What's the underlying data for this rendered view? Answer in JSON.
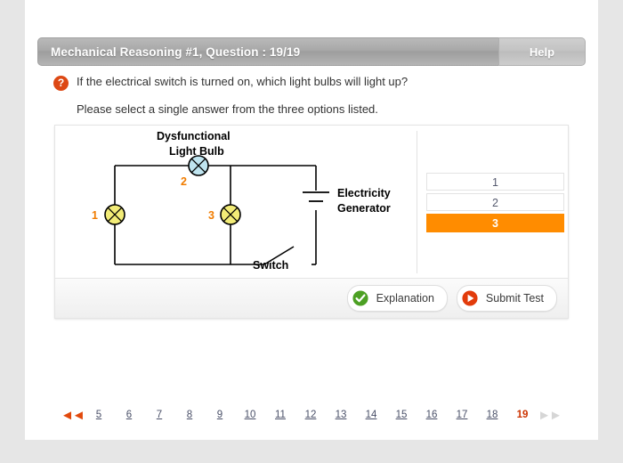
{
  "header": {
    "title": "Mechanical Reasoning #1, Question : 19/19",
    "help_label": "Help"
  },
  "question": {
    "icon": "question-mark-icon",
    "text": "If the electrical switch is turned on, which light bulbs will light up?",
    "instruction": "Please select a single answer from the three options listed."
  },
  "diagram": {
    "labels": {
      "dysfunctional_line1": "Dysfunctional",
      "dysfunctional_line2": "Light Bulb",
      "generator_line1": "Electricity",
      "generator_line2": "Generator",
      "switch": "Switch"
    },
    "bulbs": [
      {
        "number": "1",
        "state": "lit",
        "color": "#f2ec77"
      },
      {
        "number": "2",
        "state": "dysfunctional",
        "color": "#bfe4ef"
      },
      {
        "number": "3",
        "state": "lit",
        "color": "#f2ec77"
      }
    ],
    "accent_color": "#f07c00"
  },
  "options": {
    "items": [
      {
        "label": "1",
        "selected": false
      },
      {
        "label": "2",
        "selected": false
      },
      {
        "label": "3",
        "selected": true
      }
    ],
    "selected_color": "#ff8c00"
  },
  "footer": {
    "explanation_label": "Explanation",
    "explanation_icon": "check-circle-icon",
    "explanation_color": "#4ca023",
    "submit_label": "Submit Test",
    "submit_icon": "play-circle-icon",
    "submit_color": "#e23b0b"
  },
  "pagination": {
    "prev_icon": "double-left-arrow-icon",
    "next_icon": "double-right-arrow-icon",
    "pages": [
      "5",
      "6",
      "7",
      "8",
      "9",
      "10",
      "11",
      "12",
      "13",
      "14",
      "15",
      "16",
      "17",
      "18",
      "19"
    ],
    "current": "19",
    "prev_color": "#e2490c",
    "next_color": "#d6d6d6",
    "current_color": "#cc3300"
  }
}
